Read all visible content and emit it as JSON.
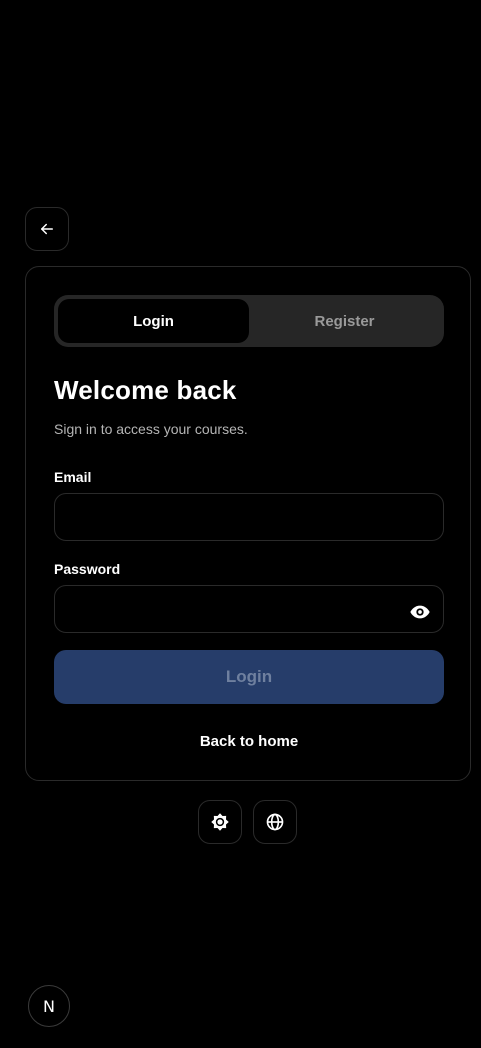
{
  "back_button": {
    "icon": "arrow-left-icon"
  },
  "tabs": [
    {
      "label": "Login",
      "active": true
    },
    {
      "label": "Register",
      "active": false
    }
  ],
  "form": {
    "title": "Welcome back",
    "subtitle": "Sign in to access your courses.",
    "email_label": "Email",
    "email_value": "",
    "password_label": "Password",
    "password_value": "",
    "submit_label": "Login",
    "back_home_label": "Back to home"
  },
  "footer_controls": {
    "theme_icon": "sun-gear-icon",
    "language_icon": "globe-icon"
  },
  "badge": {
    "letter": "N"
  },
  "colors": {
    "background": "#000000",
    "border": "#2a2a2a",
    "tab_track": "#262626",
    "button_primary": "#263d6a",
    "button_text_disabled": "#6f809f"
  }
}
